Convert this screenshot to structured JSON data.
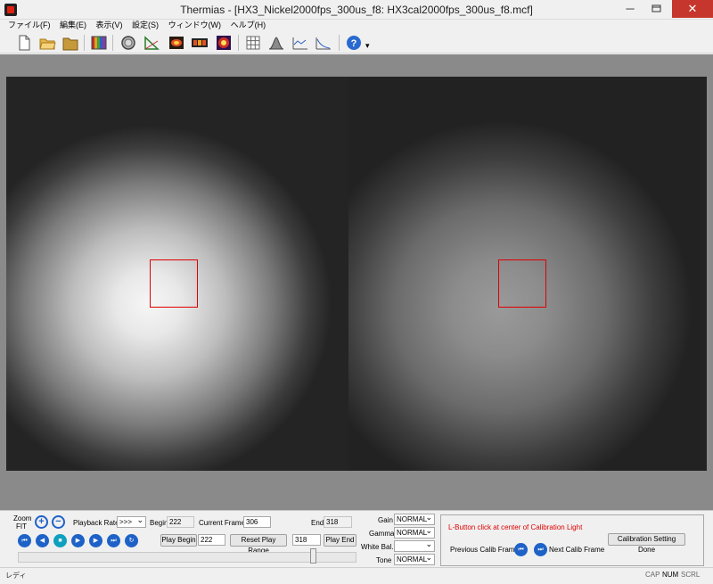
{
  "window": {
    "title": "Thermias - [HX3_Nickel2000fps_300us_f8: HX3cal2000fps_300us_f8.mcf]",
    "minimize": "─",
    "close": "✕"
  },
  "menu": [
    "ファイル(F)",
    "編集(E)",
    "表示(V)",
    "設定(S)",
    "ウィンドウ(W)",
    "ヘルプ(H)"
  ],
  "toolbar": {
    "help_dropdown": "▾"
  },
  "controls": {
    "zoom_label_1": "Zoom",
    "zoom_label_2": "FIT",
    "playback_rate_label": "Playback Rate",
    "playback_rate_value": ">>>",
    "begin_label": "Begin",
    "begin_value": "222",
    "current_frame_label": "Current Frame",
    "current_frame_value": "306",
    "end_label": "End",
    "end_value": "318",
    "play_begin_button": "Play Begin",
    "play_begin_value": "222",
    "reset_play_range_button": "Reset Play Range",
    "play_end_value": "318",
    "play_end_button": "Play End",
    "frame_position": 0.88
  },
  "image_settings": {
    "gain_label": "Gain",
    "gain_value": "NORMAL",
    "gamma_label": "Gamma",
    "gamma_value": "NORMAL",
    "white_balance_label": "White Bal.",
    "white_balance_value": "",
    "tone_label": "Tone",
    "tone_value": "NORMAL"
  },
  "calibration": {
    "instruction": "L-Button click at center of Calibration Light",
    "instruction_color": "#e00000",
    "previous_label": "Previous Calib Frame",
    "next_label": "Next Calib Frame",
    "done_button": "Calibration Setting Done"
  },
  "status": {
    "text": "レディ",
    "cap": "CAP",
    "num": "NUM",
    "scrl": "SCRL"
  }
}
